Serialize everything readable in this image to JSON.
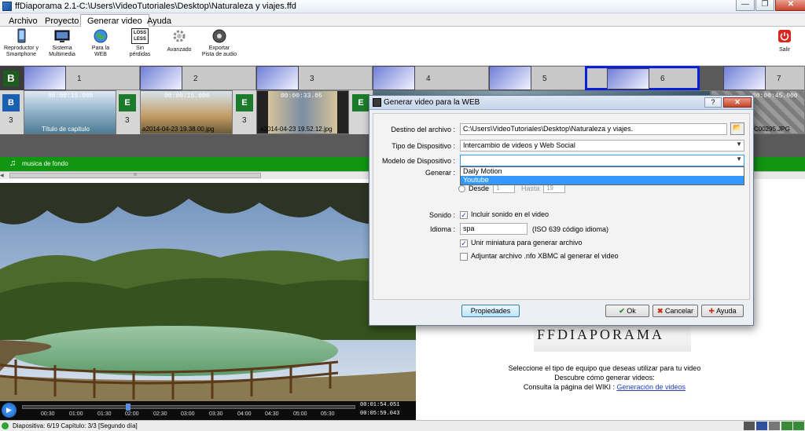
{
  "window": {
    "title": "ffDiaporama 2.1-C:\\Users\\VideoTutoriales\\Desktop\\Naturaleza y viajes.ffd",
    "min_glyph": "—",
    "max_glyph": "❐",
    "close_glyph": "✕"
  },
  "menu": {
    "tabs": [
      {
        "label": "Archivo"
      },
      {
        "label": "Proyecto"
      },
      {
        "label": "Generar video"
      },
      {
        "label": "Ayuda"
      }
    ]
  },
  "ribbon": {
    "buttons": [
      {
        "label1": "Reproductor y",
        "label2": "Smartphone",
        "icon": "smartphone-icon"
      },
      {
        "label1": "Sistema",
        "label2": "Multimedia",
        "icon": "multimedia-icon"
      },
      {
        "label1": "Para la",
        "label2": "WEB",
        "icon": "globe-icon"
      },
      {
        "label1": "Sin",
        "label2": "pérdidas",
        "icon": "lossless-icon"
      },
      {
        "label1": "Avanzado",
        "label2": "",
        "icon": "gear-icon"
      },
      {
        "label1": "Exportar",
        "label2": "Pista de audio",
        "icon": "audio-export-icon"
      }
    ],
    "exit_label": "Salir",
    "lossless_glyph": "LOSS LESS"
  },
  "timeline": {
    "slide_numbers": [
      "1",
      "2",
      "3",
      "4",
      "5",
      "6",
      "7"
    ],
    "items": [
      {
        "time": "00:00:15.000",
        "name": "Título de capitulo",
        "count": "3"
      },
      {
        "time": "00:00:15.000",
        "name": "a2014-04-23 19.38.00.jpg",
        "count": "3"
      },
      {
        "time": "00:00:33.05",
        "name": "a2014-04-23 19.52.12.jpg",
        "count": "3"
      },
      {
        "time": "00:00:45.000",
        "name": "C00295.JPG",
        "count": ""
      }
    ],
    "music_label": "musica de fondo",
    "scroll_mark": "lll"
  },
  "player": {
    "time_current": "00:01:54.051",
    "time_total": "00:05:59.043",
    "ticks": [
      "00:30",
      "01:00",
      "01:30",
      "02:00",
      "02:30",
      "03:00",
      "03:30",
      "04:00",
      "04:30",
      "05:00",
      "05:30"
    ]
  },
  "right_pane": {
    "logo_text": "FFDIAPORAMA",
    "line1": "Seleccione el tipo de equipo que deseas utilizar para tu video",
    "line2": "Descubre cómo generar videos:",
    "line3_prefix": "Consulta la página del WIKI : ",
    "line3_link": "Generación de videos"
  },
  "statusbar": {
    "text": "Diapositiva: 6/19   Capítulo: 3/3 [Segundo día]"
  },
  "dialog": {
    "title": "Generar video para la WEB",
    "close_glyph": "✕",
    "help_glyph": "?",
    "destino_label": "Destino del archivo :",
    "destino_value": "C:\\Users\\VideoTutoriales\\Desktop\\Naturaleza y viajes.",
    "tipo_label": "Tipo de Dispositivo :",
    "tipo_value": "Intercambio de videos y Web Social",
    "modelo_label": "Modelo de Dispositivo :",
    "modelo_value": "",
    "modelo_options": [
      "Daily Motion",
      "Youtube"
    ],
    "generar_label": "Generar :",
    "desde_label": "Desde",
    "desde_value": "1",
    "hasta_label": "Hasta",
    "hasta_value": "19",
    "sonido_label": "Sonido :",
    "sonido_check": "Incluir sonido en el video",
    "idioma_label": "Idioma :",
    "idioma_value": "spa",
    "idioma_hint": "(ISO 639 código idioma)",
    "miniatura_check": "Unir miniatura para generar archivo",
    "nfo_check": "Adjuntar archivo .nfo XBMC al generar el video",
    "propiedades_label": "Propiedades",
    "ok_label": "Ok",
    "cancel_label": "Cancelar",
    "help_label": "Ayuda"
  },
  "colors": {
    "music_track": "#119611",
    "selection": "#0a1fd6",
    "dropdown_highlight": "#3399ff"
  }
}
